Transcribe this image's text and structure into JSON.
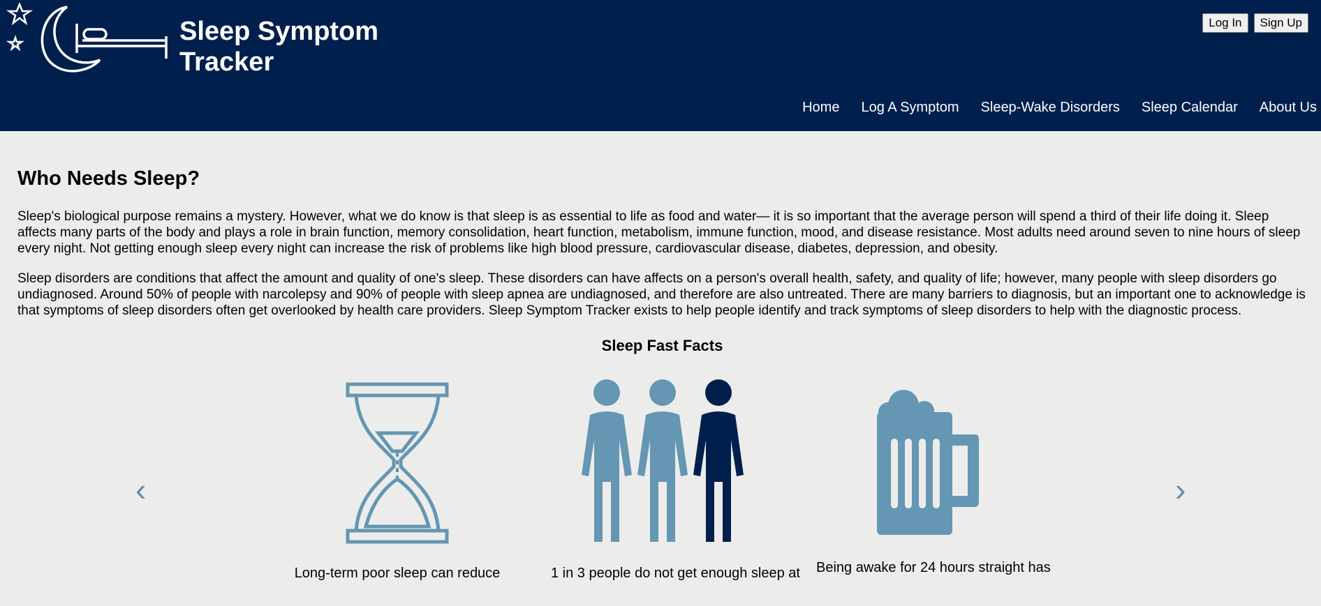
{
  "header": {
    "title_line1": "Sleep Symptom",
    "title_line2": "Tracker",
    "login_label": "Log In",
    "signup_label": "Sign Up"
  },
  "nav": {
    "items": [
      "Home",
      "Log A Symptom",
      "Sleep-Wake Disorders",
      "Sleep Calendar",
      "About Us"
    ]
  },
  "main": {
    "heading": "Who Needs Sleep?",
    "paragraph1": "Sleep's biological purpose remains a mystery. However, what we do know is that sleep is as essential to life as food and water— it is so important that the average person will spend a third of their life doing it. Sleep affects many parts of the body and plays a role in brain function, memory consolidation, heart function, metabolism, immune function, mood, and disease resistance. Most adults need around seven to nine hours of sleep every night. Not getting enough sleep every night can increase the risk of problems like high blood pressure, cardiovascular disease, diabetes, depression, and obesity.",
    "paragraph2": "Sleep disorders are conditions that affect the amount and quality of one's sleep. These disorders can have affects on a person's overall health, safety, and quality of life; however, many people with sleep disorders go undiagnosed. Around 50% of people with narcolepsy and 90% of people with sleep apnea are undiagnosed, and therefore are also untreated. There are many barriers to diagnosis, but an important one to acknowledge is that symptoms of sleep disorders often get overlooked by health care providers. Sleep Symptom Tracker exists to help people identify and track symptoms of sleep disorders to help with the diagnostic process."
  },
  "facts": {
    "heading": "Sleep Fast Facts",
    "prev_arrow": "‹",
    "next_arrow": "›",
    "items": [
      {
        "icon": "hourglass-icon",
        "caption": "Long-term poor sleep can reduce"
      },
      {
        "icon": "people-icon",
        "caption": "1 in 3 people do not get enough sleep at"
      },
      {
        "icon": "beer-mug-icon",
        "caption": "Being awake for 24 hours straight has"
      }
    ]
  },
  "colors": {
    "header_bg": "#001f4d",
    "page_bg": "#ecedeb",
    "icon_light": "#6596b3",
    "icon_dark": "#001f4d"
  }
}
